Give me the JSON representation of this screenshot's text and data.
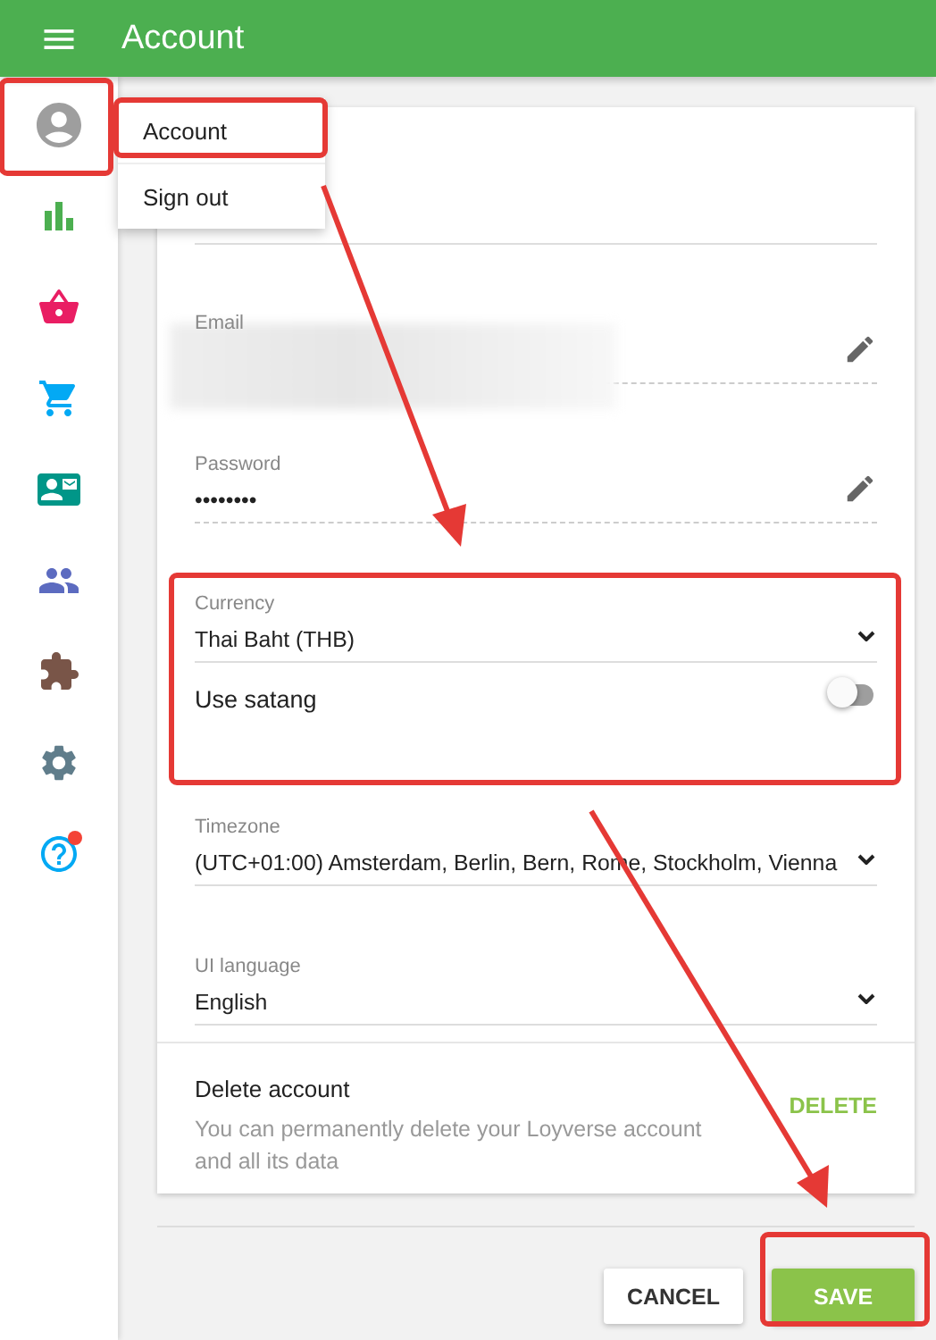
{
  "header": {
    "title": "Account"
  },
  "menu": {
    "items": [
      {
        "label": "Account",
        "selected": true
      },
      {
        "label": "Sign out",
        "selected": false
      }
    ]
  },
  "fields": [
    {
      "kind": "blurred",
      "label": "Email",
      "editable": true
    },
    {
      "kind": "text",
      "label": "Password",
      "value": "••••••••",
      "editable": true
    },
    {
      "kind": "select",
      "label": "Currency",
      "value": "Thai Baht (THB)"
    },
    {
      "kind": "toggle",
      "label": "Use satang",
      "on": false
    },
    {
      "kind": "select",
      "label": "Timezone",
      "value": "(UTC+01:00) Amsterdam, Berlin, Bern, Rome, Stockholm, Vienna"
    },
    {
      "kind": "select",
      "label": "UI language",
      "value": "English"
    }
  ],
  "delete_section": {
    "title": "Delete account",
    "description": "You can permanently delete your Loyverse account and all its data",
    "action": "DELETE"
  },
  "buttons": [
    {
      "kind": "secondary",
      "label": "CANCEL"
    },
    {
      "kind": "primary",
      "label": "SAVE"
    }
  ]
}
